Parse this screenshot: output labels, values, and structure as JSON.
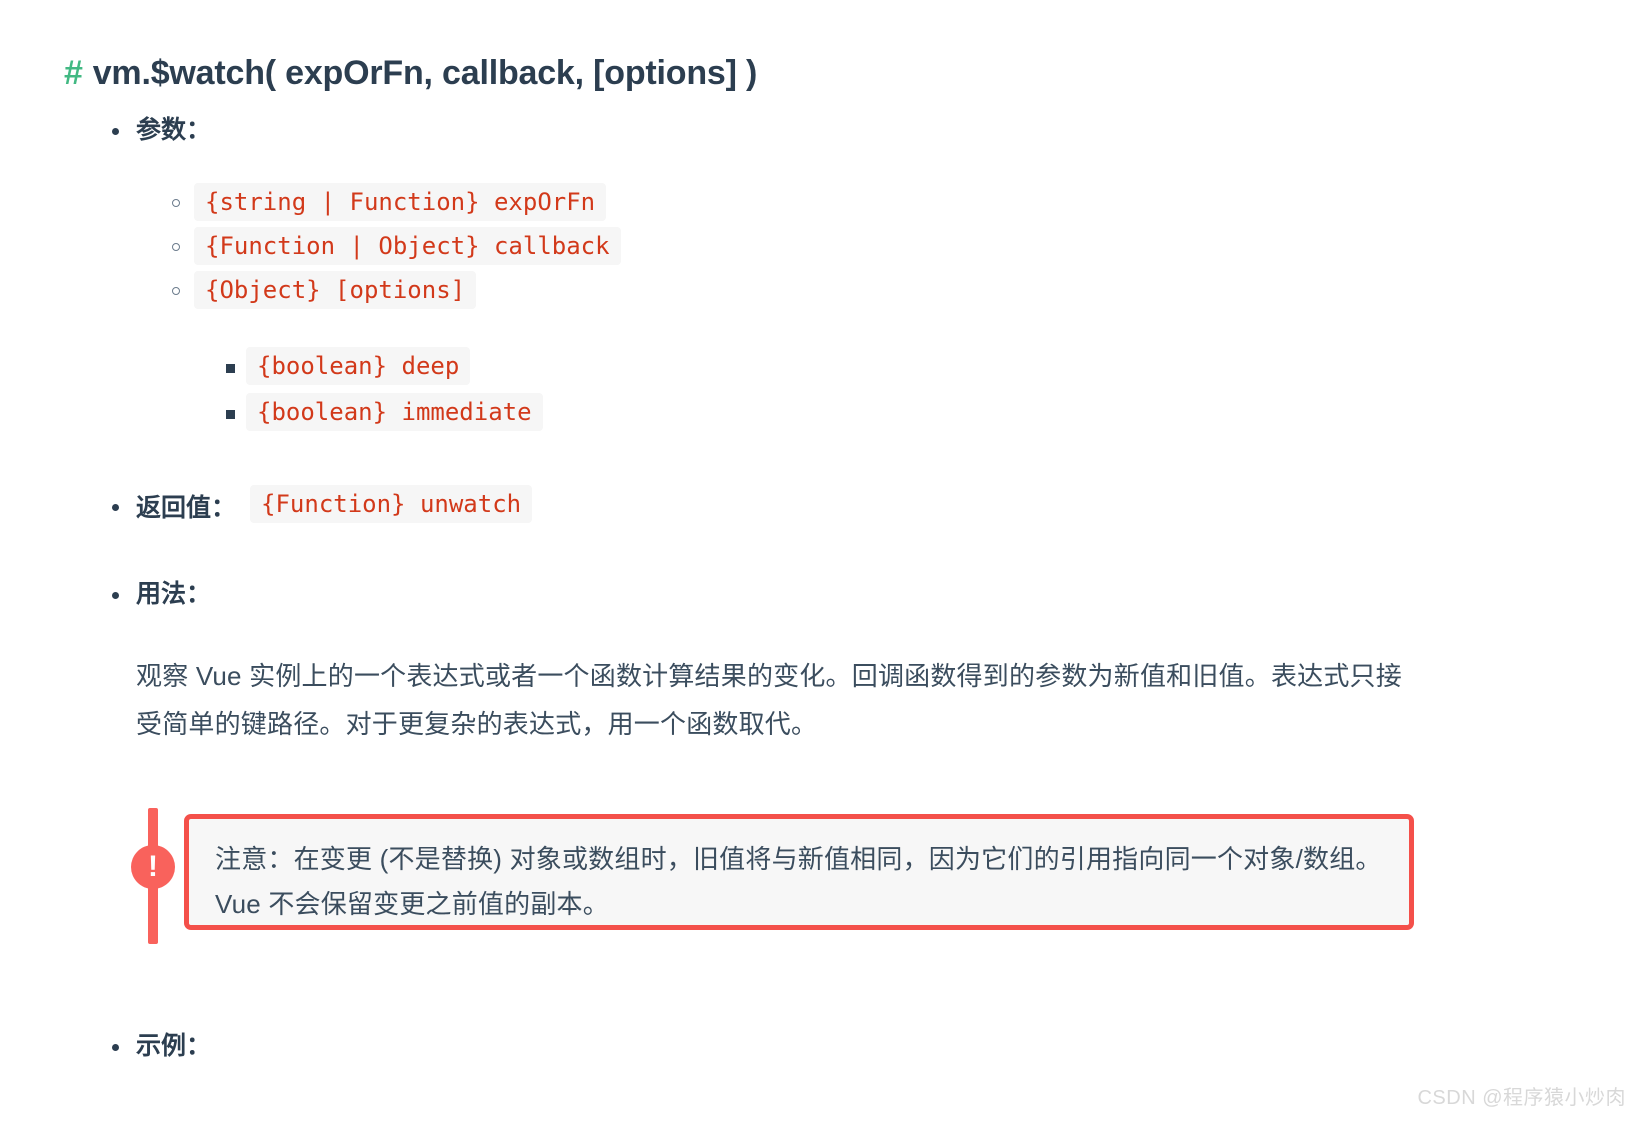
{
  "heading": {
    "anchor": "#",
    "title": "vm.$watch( expOrFn, callback, [options] )"
  },
  "sections": {
    "params": {
      "label": "参数：",
      "items": [
        "{string | Function} expOrFn",
        "{Function | Object} callback",
        "{Object} [options]"
      ],
      "sub_items": [
        "{boolean} deep",
        "{boolean} immediate"
      ]
    },
    "returns": {
      "label": "返回值：",
      "code": "{Function} unwatch"
    },
    "usage": {
      "label": "用法：",
      "paragraph": "观察 Vue 实例上的一个表达式或者一个函数计算结果的变化。回调函数得到的参数为新值和旧值。表达式只接受简单的键路径。对于更复杂的表达式，用一个函数取代。"
    },
    "example": {
      "label": "示例："
    }
  },
  "callout": {
    "icon": "!",
    "text": "注意：在变更 (不是替换) 对象或数组时，旧值将与新值相同，因为它们的引用指向同一个对象/数组。Vue 不会保留变更之前值的副本。"
  },
  "watermark": "CSDN @程序猿小炒肉",
  "colors": {
    "anchor_green": "#42b983",
    "code_red": "#d2391a",
    "callout_red": "#f4504a",
    "text_navy": "#2c3e50"
  }
}
